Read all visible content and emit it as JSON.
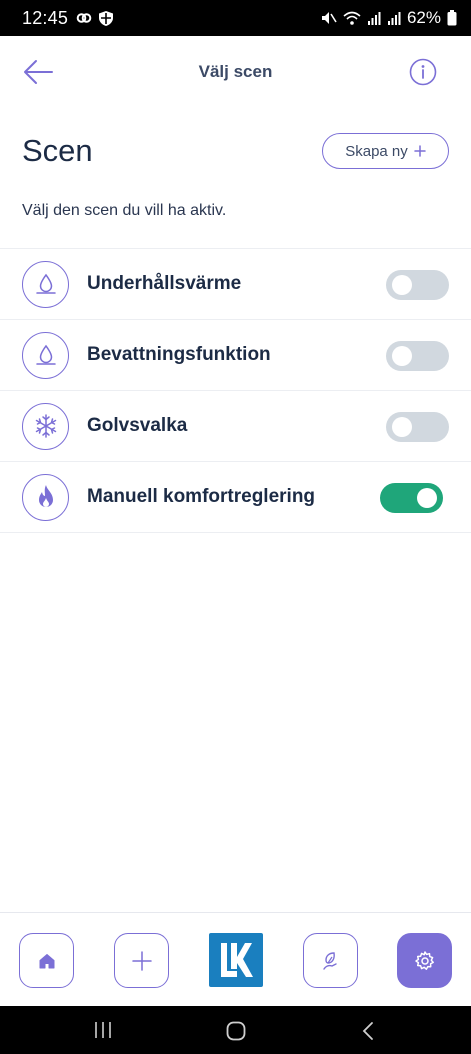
{
  "status_bar": {
    "time": "12:45",
    "battery_percent": "62%",
    "icons": [
      "link-icon",
      "shield-icon",
      "mute-icon",
      "wifi-icon",
      "signal-icon",
      "signal-icon",
      "battery-icon"
    ]
  },
  "header": {
    "title": "Välj scen",
    "back_icon": "arrow-left-icon",
    "info_icon": "info-icon"
  },
  "page": {
    "title": "Scen",
    "create_button": "Skapa ny",
    "create_icon": "plus-icon",
    "subtitle": "Välj den scen du vill ha aktiv."
  },
  "scenes": [
    {
      "label": "Underhållsvärme",
      "icon": "water-drop-icon",
      "active": false
    },
    {
      "label": "Bevattningsfunktion",
      "icon": "water-drop-icon",
      "active": false
    },
    {
      "label": "Golvsvalka",
      "icon": "snowflake-icon",
      "active": false
    },
    {
      "label": "Manuell komfortreglering",
      "icon": "flame-icon",
      "active": true
    }
  ],
  "bottom_nav": {
    "items": [
      "home-icon",
      "plus-icon",
      "lk-logo",
      "leaf-hand-icon",
      "gear-icon"
    ],
    "active": "gear-icon"
  },
  "colors": {
    "accent": "#7b6fd6",
    "toggle_on": "#1fa67a",
    "toggle_off": "#d1d8df",
    "text": "#1c2b45",
    "lk_blue": "#1a7fbf"
  }
}
